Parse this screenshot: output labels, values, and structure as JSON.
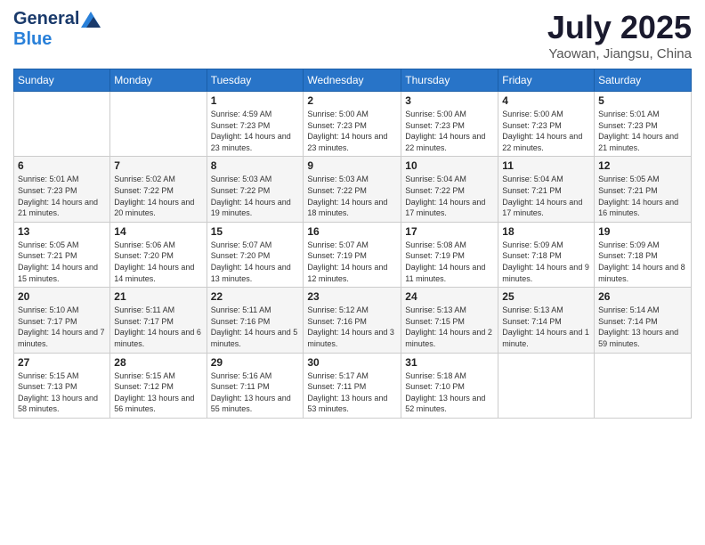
{
  "header": {
    "logo": {
      "general": "General",
      "blue": "Blue"
    },
    "title": "July 2025",
    "location": "Yaowan, Jiangsu, China"
  },
  "weekdays": [
    "Sunday",
    "Monday",
    "Tuesday",
    "Wednesday",
    "Thursday",
    "Friday",
    "Saturday"
  ],
  "weeks": [
    [
      {
        "day": null
      },
      {
        "day": null
      },
      {
        "day": "1",
        "sunrise": "Sunrise: 4:59 AM",
        "sunset": "Sunset: 7:23 PM",
        "daylight": "Daylight: 14 hours and 23 minutes."
      },
      {
        "day": "2",
        "sunrise": "Sunrise: 5:00 AM",
        "sunset": "Sunset: 7:23 PM",
        "daylight": "Daylight: 14 hours and 23 minutes."
      },
      {
        "day": "3",
        "sunrise": "Sunrise: 5:00 AM",
        "sunset": "Sunset: 7:23 PM",
        "daylight": "Daylight: 14 hours and 22 minutes."
      },
      {
        "day": "4",
        "sunrise": "Sunrise: 5:00 AM",
        "sunset": "Sunset: 7:23 PM",
        "daylight": "Daylight: 14 hours and 22 minutes."
      },
      {
        "day": "5",
        "sunrise": "Sunrise: 5:01 AM",
        "sunset": "Sunset: 7:23 PM",
        "daylight": "Daylight: 14 hours and 21 minutes."
      }
    ],
    [
      {
        "day": "6",
        "sunrise": "Sunrise: 5:01 AM",
        "sunset": "Sunset: 7:23 PM",
        "daylight": "Daylight: 14 hours and 21 minutes."
      },
      {
        "day": "7",
        "sunrise": "Sunrise: 5:02 AM",
        "sunset": "Sunset: 7:22 PM",
        "daylight": "Daylight: 14 hours and 20 minutes."
      },
      {
        "day": "8",
        "sunrise": "Sunrise: 5:03 AM",
        "sunset": "Sunset: 7:22 PM",
        "daylight": "Daylight: 14 hours and 19 minutes."
      },
      {
        "day": "9",
        "sunrise": "Sunrise: 5:03 AM",
        "sunset": "Sunset: 7:22 PM",
        "daylight": "Daylight: 14 hours and 18 minutes."
      },
      {
        "day": "10",
        "sunrise": "Sunrise: 5:04 AM",
        "sunset": "Sunset: 7:22 PM",
        "daylight": "Daylight: 14 hours and 17 minutes."
      },
      {
        "day": "11",
        "sunrise": "Sunrise: 5:04 AM",
        "sunset": "Sunset: 7:21 PM",
        "daylight": "Daylight: 14 hours and 17 minutes."
      },
      {
        "day": "12",
        "sunrise": "Sunrise: 5:05 AM",
        "sunset": "Sunset: 7:21 PM",
        "daylight": "Daylight: 14 hours and 16 minutes."
      }
    ],
    [
      {
        "day": "13",
        "sunrise": "Sunrise: 5:05 AM",
        "sunset": "Sunset: 7:21 PM",
        "daylight": "Daylight: 14 hours and 15 minutes."
      },
      {
        "day": "14",
        "sunrise": "Sunrise: 5:06 AM",
        "sunset": "Sunset: 7:20 PM",
        "daylight": "Daylight: 14 hours and 14 minutes."
      },
      {
        "day": "15",
        "sunrise": "Sunrise: 5:07 AM",
        "sunset": "Sunset: 7:20 PM",
        "daylight": "Daylight: 14 hours and 13 minutes."
      },
      {
        "day": "16",
        "sunrise": "Sunrise: 5:07 AM",
        "sunset": "Sunset: 7:19 PM",
        "daylight": "Daylight: 14 hours and 12 minutes."
      },
      {
        "day": "17",
        "sunrise": "Sunrise: 5:08 AM",
        "sunset": "Sunset: 7:19 PM",
        "daylight": "Daylight: 14 hours and 11 minutes."
      },
      {
        "day": "18",
        "sunrise": "Sunrise: 5:09 AM",
        "sunset": "Sunset: 7:18 PM",
        "daylight": "Daylight: 14 hours and 9 minutes."
      },
      {
        "day": "19",
        "sunrise": "Sunrise: 5:09 AM",
        "sunset": "Sunset: 7:18 PM",
        "daylight": "Daylight: 14 hours and 8 minutes."
      }
    ],
    [
      {
        "day": "20",
        "sunrise": "Sunrise: 5:10 AM",
        "sunset": "Sunset: 7:17 PM",
        "daylight": "Daylight: 14 hours and 7 minutes."
      },
      {
        "day": "21",
        "sunrise": "Sunrise: 5:11 AM",
        "sunset": "Sunset: 7:17 PM",
        "daylight": "Daylight: 14 hours and 6 minutes."
      },
      {
        "day": "22",
        "sunrise": "Sunrise: 5:11 AM",
        "sunset": "Sunset: 7:16 PM",
        "daylight": "Daylight: 14 hours and 5 minutes."
      },
      {
        "day": "23",
        "sunrise": "Sunrise: 5:12 AM",
        "sunset": "Sunset: 7:16 PM",
        "daylight": "Daylight: 14 hours and 3 minutes."
      },
      {
        "day": "24",
        "sunrise": "Sunrise: 5:13 AM",
        "sunset": "Sunset: 7:15 PM",
        "daylight": "Daylight: 14 hours and 2 minutes."
      },
      {
        "day": "25",
        "sunrise": "Sunrise: 5:13 AM",
        "sunset": "Sunset: 7:14 PM",
        "daylight": "Daylight: 14 hours and 1 minute."
      },
      {
        "day": "26",
        "sunrise": "Sunrise: 5:14 AM",
        "sunset": "Sunset: 7:14 PM",
        "daylight": "Daylight: 13 hours and 59 minutes."
      }
    ],
    [
      {
        "day": "27",
        "sunrise": "Sunrise: 5:15 AM",
        "sunset": "Sunset: 7:13 PM",
        "daylight": "Daylight: 13 hours and 58 minutes."
      },
      {
        "day": "28",
        "sunrise": "Sunrise: 5:15 AM",
        "sunset": "Sunset: 7:12 PM",
        "daylight": "Daylight: 13 hours and 56 minutes."
      },
      {
        "day": "29",
        "sunrise": "Sunrise: 5:16 AM",
        "sunset": "Sunset: 7:11 PM",
        "daylight": "Daylight: 13 hours and 55 minutes."
      },
      {
        "day": "30",
        "sunrise": "Sunrise: 5:17 AM",
        "sunset": "Sunset: 7:11 PM",
        "daylight": "Daylight: 13 hours and 53 minutes."
      },
      {
        "day": "31",
        "sunrise": "Sunrise: 5:18 AM",
        "sunset": "Sunset: 7:10 PM",
        "daylight": "Daylight: 13 hours and 52 minutes."
      },
      {
        "day": null
      },
      {
        "day": null
      }
    ]
  ]
}
